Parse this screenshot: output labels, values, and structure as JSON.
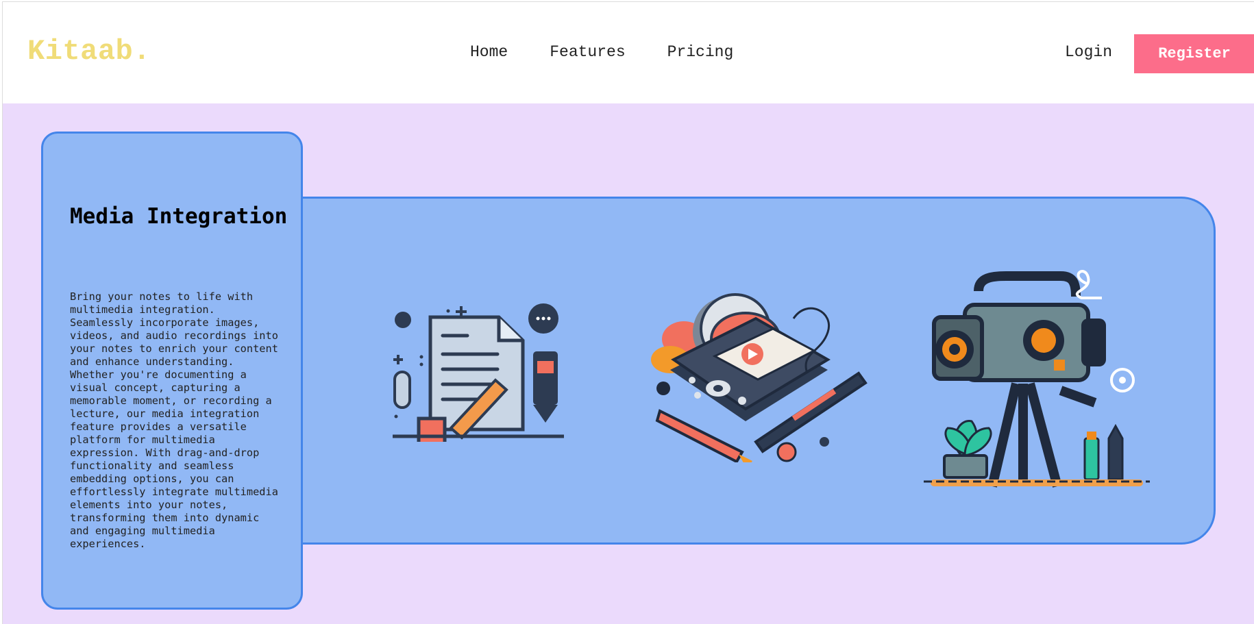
{
  "nav": {
    "logo": "Kitaab.",
    "menu": [
      {
        "label": "Home"
      },
      {
        "label": "Features"
      },
      {
        "label": "Pricing"
      }
    ],
    "login_label": "Login",
    "register_label": "Register"
  },
  "feature": {
    "title": "Media Integration",
    "description": "Bring your notes to life with multimedia integration. Seamlessly incorporate images, videos, and audio recordings into your notes to enrich your content and enhance understanding. Whether you're documenting a visual concept, capturing a memorable moment, or recording a lecture, our media integration feature provides a versatile platform for multimedia expression. With drag-and-drop functionality and seamless embedding options, you can effortlessly integrate multimedia elements into your notes, transforming them into dynamic and engaging multimedia experiences."
  },
  "illustrations": [
    {
      "icon": "document-pencil-illustration"
    },
    {
      "icon": "media-player-illustration"
    },
    {
      "icon": "video-camera-illustration"
    }
  ],
  "colors": {
    "logo": "#f0dc78",
    "register_button": "#fc6d8a",
    "page_background": "#ebdafc",
    "panel": "#91b8f5",
    "panel_border": "#4485ea"
  }
}
